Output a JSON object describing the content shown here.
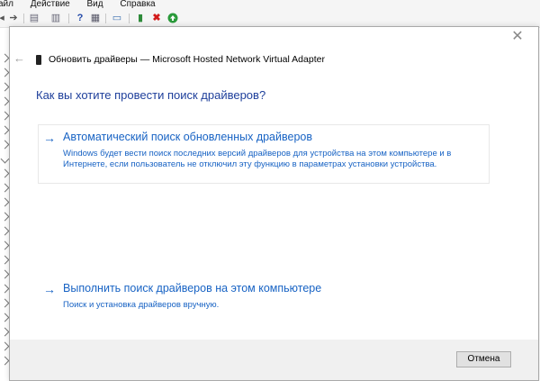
{
  "menubar": {
    "items": [
      "айл",
      "Действие",
      "Вид",
      "Справка"
    ]
  },
  "toolbar": {
    "icons": [
      "back-icon",
      "forward-icon",
      "properties-icon",
      "view-icon",
      "help-icon",
      "device-icon",
      "monitor-icon",
      "update-driver-icon",
      "disable-icon",
      "enable-icon"
    ]
  },
  "dialog": {
    "close_glyph": "✕",
    "back_glyph": "←",
    "title": "Обновить драйверы — Microsoft Hosted Network Virtual Adapter",
    "question": "Как вы хотите провести поиск драйверов?",
    "options": [
      {
        "arrow": "→",
        "title": "Автоматический поиск обновленных драйверов",
        "description": "Windows будет вести поиск последних версий драйверов для устройства на этом компьютере и в Интернете, если пользователь не отключил эту функцию в параметрах установки устройства."
      },
      {
        "arrow": "→",
        "title": "Выполнить поиск драйверов на этом компьютере",
        "description": "Поиск и установка драйверов вручную."
      }
    ],
    "cancel_label": "Отмена"
  },
  "colors": {
    "link_blue": "#1863c4",
    "heading_blue": "#1e3f9b",
    "footer_bg": "#f0f0f0"
  }
}
